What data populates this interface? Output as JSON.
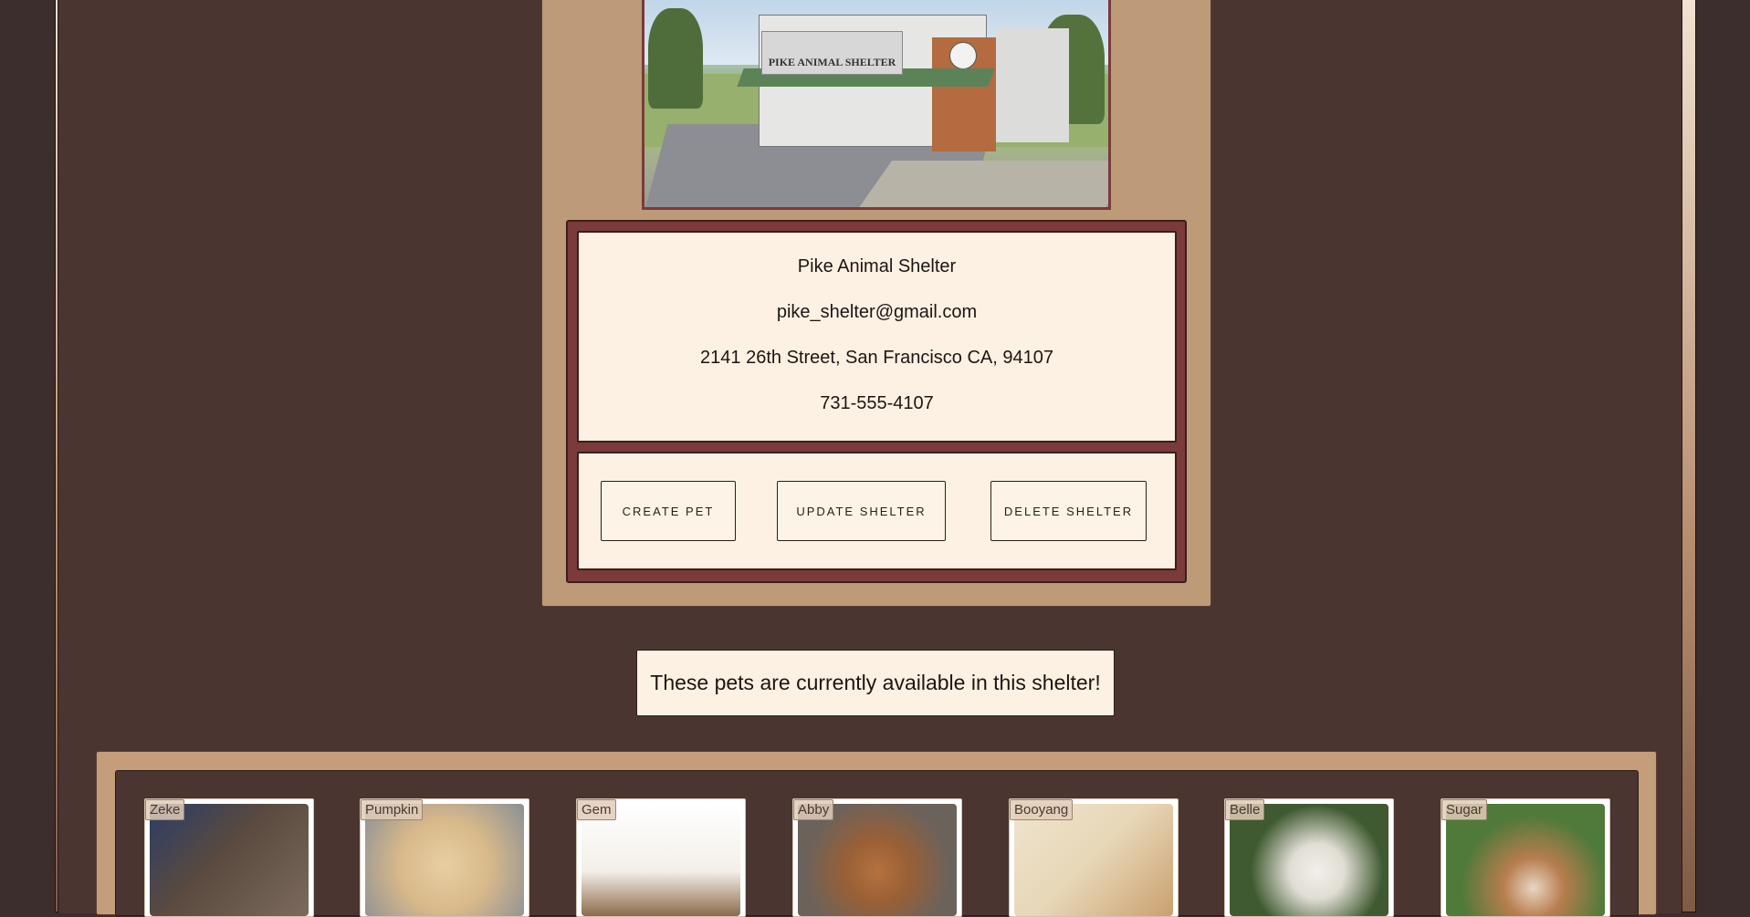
{
  "shelter": {
    "name": "Pike Animal Shelter",
    "photo_sign_text": "PIKE ANIMAL SHELTER",
    "email": "pike_shelter@gmail.com",
    "address": "2141 26th Street, San Francisco CA, 94107",
    "phone": "731-555-4107"
  },
  "actions": {
    "create_pet": "CREATE PET",
    "update_shelter": "UPDATE SHELTER",
    "delete_shelter": "DELETE SHELTER"
  },
  "pets_section": {
    "heading": "These pets are currently available in this shelter!"
  },
  "pets": [
    {
      "name": "Zeke",
      "image_color": "#5a4a3f"
    },
    {
      "name": "Pumpkin",
      "image_color": "#d8b98a"
    },
    {
      "name": "Gem",
      "image_color": "#f4efe8"
    },
    {
      "name": "Abby",
      "image_color": "#6b625c"
    },
    {
      "name": "Booyang",
      "image_color": "#e7d6b6"
    },
    {
      "name": "Belle",
      "image_color": "#3f5a30"
    },
    {
      "name": "Sugar",
      "image_color": "#4f7a3a"
    }
  ],
  "colors": {
    "background": "#3c2e2c",
    "panel_tan": "#bd9a78",
    "panel_maroon": "#7a3b3a",
    "card_cream": "#fdf1e3"
  }
}
